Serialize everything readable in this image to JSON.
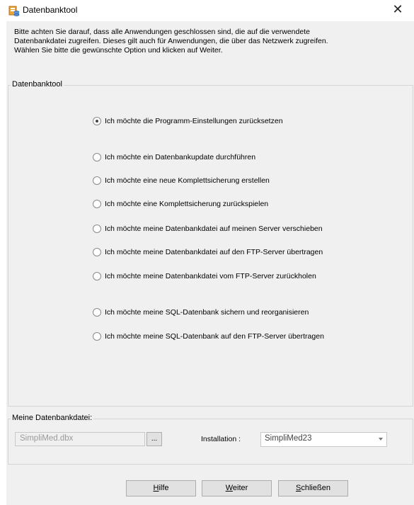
{
  "window": {
    "title": "Datenbanktool",
    "close_glyph": "✕",
    "icon": "database-app-icon"
  },
  "info_lines": [
    "Bitte achten Sie darauf, dass alle Anwendungen geschlossen sind, die auf die verwendete",
    "Datenbankdatei zugreifen. Dieses gilt auch für Anwendungen, die über das Netzwerk zugreifen.",
    "Wählen Sie bitte die gewünschte Option und klicken auf Weiter."
  ],
  "options_group": {
    "title": "Datenbanktool",
    "options": [
      {
        "label": "Ich möchte die Programm-Einstellungen zurücksetzen",
        "checked": true
      },
      {
        "label": "Ich möchte ein Datenbankupdate durchführen",
        "checked": false
      },
      {
        "label": "Ich möchte eine neue Komplettsicherung erstellen",
        "checked": false
      },
      {
        "label": "Ich möchte eine Komplettsicherung zurückspielen",
        "checked": false
      },
      {
        "label": "Ich möchte meine Datenbankdatei auf meinen Server verschieben",
        "checked": false
      },
      {
        "label": "Ich möchte meine Datenbankdatei auf den FTP-Server übertragen",
        "checked": false
      },
      {
        "label": "Ich möchte meine Datenbankdatei vom FTP-Server zurückholen",
        "checked": false
      },
      {
        "label": "Ich möchte meine SQL-Datenbank sichern und reorganisieren",
        "checked": false
      },
      {
        "label": "Ich möchte meine SQL-Datenbank auf den FTP-Server übertragen",
        "checked": false
      }
    ]
  },
  "db_group": {
    "title": "Meine Datenbankdatei:",
    "file_value": "SimpliMed.dbx",
    "browse_label": "...",
    "installation_label": "Installation :",
    "installation_value": "SimpliMed23"
  },
  "buttons": {
    "help": {
      "mnemonic": "H",
      "rest": "ilfe"
    },
    "next": {
      "mnemonic": "W",
      "rest": "eiter"
    },
    "close": {
      "mnemonic": "S",
      "rest": "chließen"
    }
  }
}
